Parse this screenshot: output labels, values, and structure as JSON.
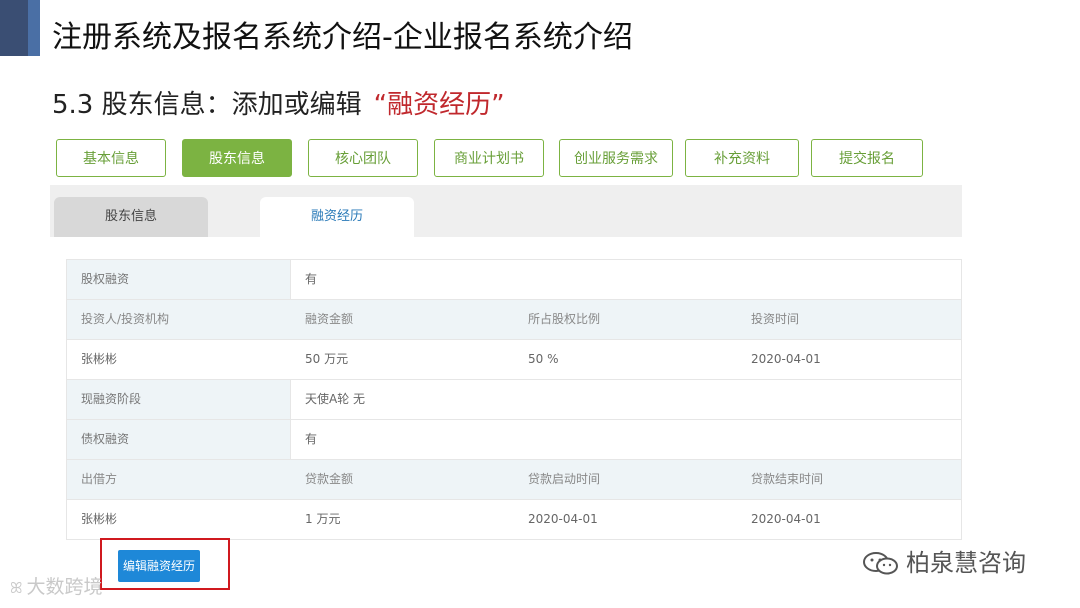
{
  "slide_title": "注册系统及报名系统介绍-企业报名系统介绍",
  "section": {
    "title_prefix": "5.3 股东信息：添加或编辑",
    "title_highlight": "“融资经历”"
  },
  "steps": [
    {
      "label": "基本信息",
      "active": false
    },
    {
      "label": "股东信息",
      "active": true
    },
    {
      "label": "核心团队",
      "active": false
    },
    {
      "label": "商业计划书",
      "active": false
    },
    {
      "label": "创业服务需求",
      "active": false
    },
    {
      "label": "补充资料",
      "active": false
    },
    {
      "label": "提交报名",
      "active": false
    }
  ],
  "tabs": {
    "shareholder_info": "股东信息",
    "financing_history": "融资经历",
    "active": "financing_history"
  },
  "grid": {
    "equity_financing": {
      "label": "股权融资",
      "value": "有"
    },
    "equity_headers": [
      "投资人/投资机构",
      "融资金额",
      "所占股权比例",
      "投资时间"
    ],
    "equity_rows": [
      [
        "张彬彬",
        "50 万元",
        "50 %",
        "2020-04-01"
      ]
    ],
    "current_stage": {
      "label": "现融资阶段",
      "value": "天使A轮 无"
    },
    "debt_financing": {
      "label": "债权融资",
      "value": "有"
    },
    "debt_headers": [
      "出借方",
      "贷款金额",
      "贷款启动时间",
      "贷款结束时间"
    ],
    "debt_rows": [
      [
        "张彬彬",
        "1 万元",
        "2020-04-01",
        "2020-04-01"
      ]
    ]
  },
  "edit_button_label": "编辑融资经历",
  "watermarks": {
    "left": "大数跨境",
    "right": "柏泉慧咨询"
  },
  "colors": {
    "step_green": "#7cb342",
    "button_blue": "#1e88d8",
    "highlight_red": "#c0282d",
    "header_bar": "#3a4e73"
  }
}
